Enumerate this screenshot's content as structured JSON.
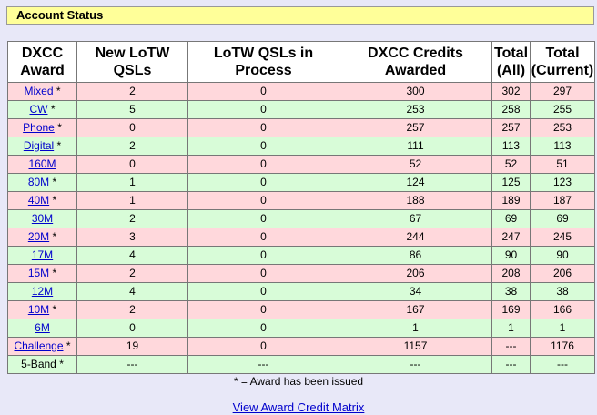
{
  "status_title": "Account Status",
  "headers": {
    "award": "DXCC Award",
    "new": "New LoTW QSLs",
    "process": "LoTW QSLs in Process",
    "credits": "DXCC Credits Awarded",
    "total_all": "Total (All)",
    "total_current": "Total (Current)"
  },
  "rows": [
    {
      "award": "Mixed",
      "link": true,
      "star": true,
      "new": "2",
      "process": "0",
      "credits": "300",
      "all": "302",
      "current": "297",
      "color": "pink"
    },
    {
      "award": "CW",
      "link": true,
      "star": true,
      "new": "5",
      "process": "0",
      "credits": "253",
      "all": "258",
      "current": "255",
      "color": "green"
    },
    {
      "award": "Phone",
      "link": true,
      "star": true,
      "new": "0",
      "process": "0",
      "credits": "257",
      "all": "257",
      "current": "253",
      "color": "pink"
    },
    {
      "award": "Digital",
      "link": true,
      "star": true,
      "new": "2",
      "process": "0",
      "credits": "111",
      "all": "113",
      "current": "113",
      "color": "green"
    },
    {
      "award": "160M",
      "link": true,
      "star": false,
      "new": "0",
      "process": "0",
      "credits": "52",
      "all": "52",
      "current": "51",
      "color": "pink"
    },
    {
      "award": "80M",
      "link": true,
      "star": true,
      "new": "1",
      "process": "0",
      "credits": "124",
      "all": "125",
      "current": "123",
      "color": "green"
    },
    {
      "award": "40M",
      "link": true,
      "star": true,
      "new": "1",
      "process": "0",
      "credits": "188",
      "all": "189",
      "current": "187",
      "color": "pink"
    },
    {
      "award": "30M",
      "link": true,
      "star": false,
      "new": "2",
      "process": "0",
      "credits": "67",
      "all": "69",
      "current": "69",
      "color": "green"
    },
    {
      "award": "20M",
      "link": true,
      "star": true,
      "new": "3",
      "process": "0",
      "credits": "244",
      "all": "247",
      "current": "245",
      "color": "pink"
    },
    {
      "award": "17M",
      "link": true,
      "star": false,
      "new": "4",
      "process": "0",
      "credits": "86",
      "all": "90",
      "current": "90",
      "color": "green"
    },
    {
      "award": "15M",
      "link": true,
      "star": true,
      "new": "2",
      "process": "0",
      "credits": "206",
      "all": "208",
      "current": "206",
      "color": "pink"
    },
    {
      "award": "12M",
      "link": true,
      "star": false,
      "new": "4",
      "process": "0",
      "credits": "34",
      "all": "38",
      "current": "38",
      "color": "green"
    },
    {
      "award": "10M",
      "link": true,
      "star": true,
      "new": "2",
      "process": "0",
      "credits": "167",
      "all": "169",
      "current": "166",
      "color": "pink"
    },
    {
      "award": "6M",
      "link": true,
      "star": false,
      "new": "0",
      "process": "0",
      "credits": "1",
      "all": "1",
      "current": "1",
      "color": "green"
    },
    {
      "award": "Challenge",
      "link": true,
      "star": true,
      "new": "19",
      "process": "0",
      "credits": "1157",
      "all": "---",
      "current": "1176",
      "color": "pink"
    },
    {
      "award": "5-Band",
      "link": false,
      "star": true,
      "new": "---",
      "process": "---",
      "credits": "---",
      "all": "---",
      "current": "---",
      "color": "green"
    }
  ],
  "star_text": "*",
  "footnote": "* = Award has been issued",
  "matrix_link": "View Award Credit Matrix"
}
